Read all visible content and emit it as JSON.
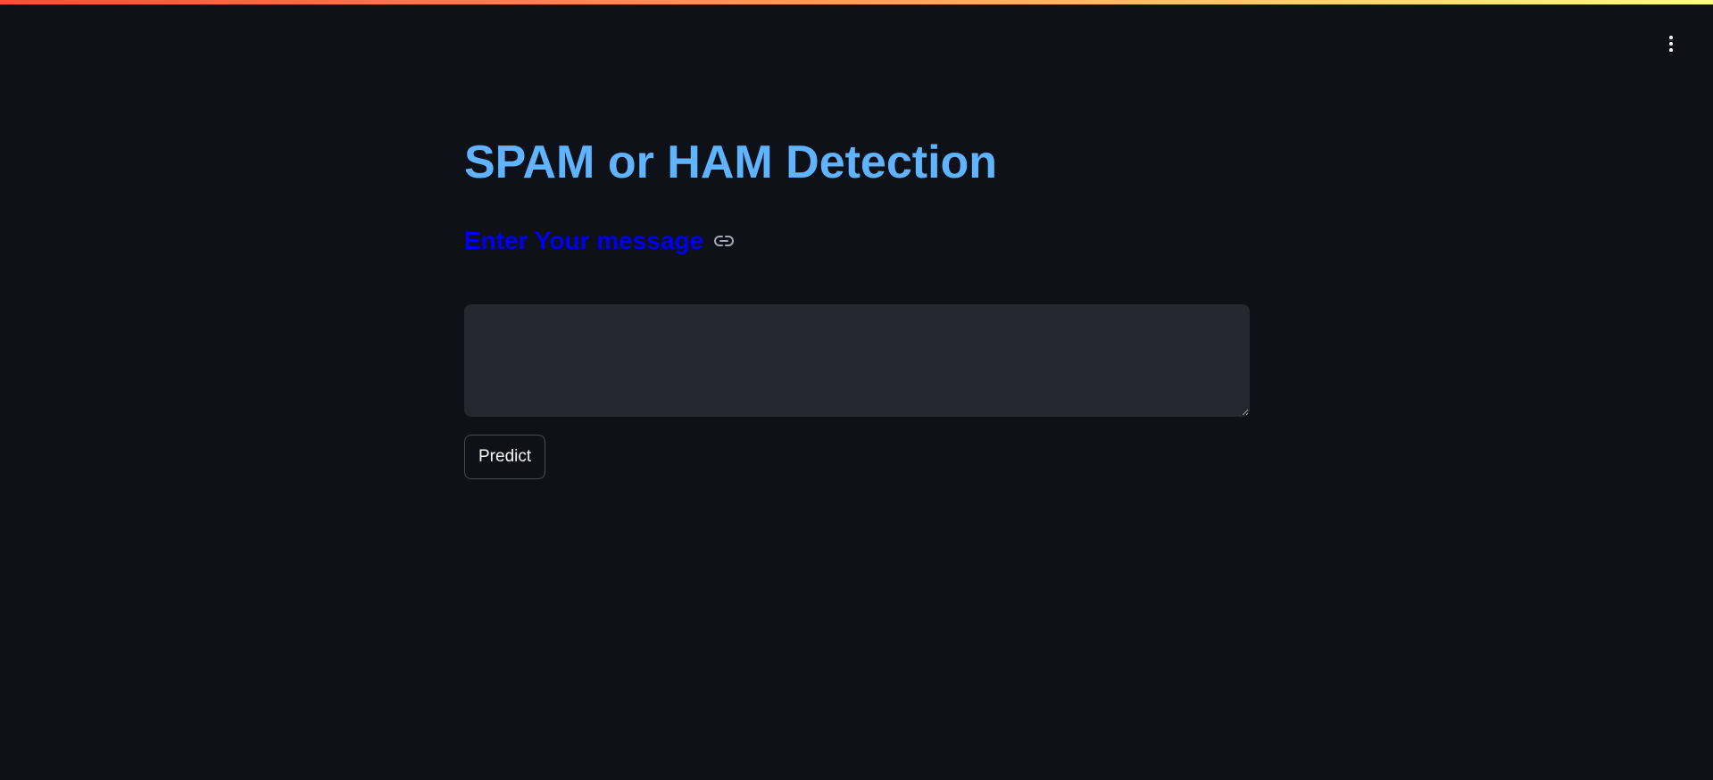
{
  "app": {
    "title": "SPAM or HAM Detection",
    "subheader": "Enter Your message"
  },
  "message_input": {
    "value": "",
    "placeholder": ""
  },
  "actions": {
    "predict_label": "Predict"
  },
  "icons": {
    "menu": "vertical-ellipsis-icon",
    "anchor": "link-icon"
  },
  "colors": {
    "background": "#0e1117",
    "title": "#60b4ff",
    "subheader": "#0000ee",
    "input_bg": "#262730",
    "top_bar_gradient": [
      "#ff4b4b",
      "#ff9f5a",
      "#fffd80"
    ]
  }
}
